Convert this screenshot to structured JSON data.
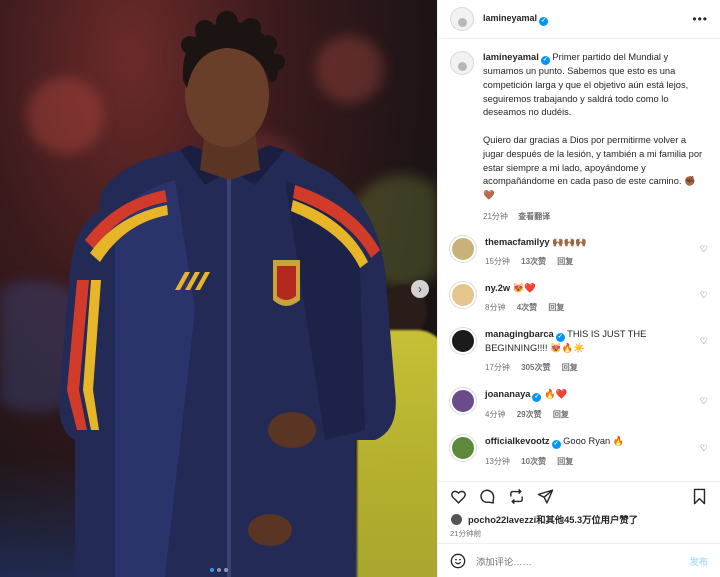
{
  "post": {
    "username": "lamineyamal",
    "more_label": "•••"
  },
  "caption": {
    "username": "lamineyamal",
    "text_1": "Primer partido del Mundial y sumamos un punto. Sabemos que esto es una competición larga y que el objetivo aún está lejos, seguiremos trabajando y saldrá todo como lo deseamos no dudéis.",
    "text_2": "Quiero dar gracias a Dios por permitirme volver a jugar después de la lesión, y también a mi familia por estar siempre a mi lado, apoyándome y acompañándome en cada paso de este camino. ✊🏾",
    "emoji": "🤎",
    "time": "21分钟",
    "translate": "查看翻译"
  },
  "comments": [
    {
      "username": "themacfamilyy",
      "text": "🙌🏾🙌🏾🙌🏾",
      "time": "15分钟",
      "likes": "13次赞",
      "reply": "回复",
      "verified": false,
      "avatar_color": "#c8b27a"
    },
    {
      "username": "ny.2w",
      "text": "😻❤️",
      "time": "8分钟",
      "likes": "4次赞",
      "reply": "回复",
      "verified": false,
      "avatar_color": "#e6c58c"
    },
    {
      "username": "managingbarca",
      "text": "THIS IS JUST THE BEGINNING!!!! 😻🔥☀️",
      "time": "17分钟",
      "likes": "305次赞",
      "reply": "回复",
      "verified": true,
      "avatar_color": "#1b1b1b"
    },
    {
      "username": "joananaya",
      "text": "🔥❤️",
      "time": "4分钟",
      "likes": "29次赞",
      "reply": "回复",
      "verified": true,
      "avatar_color": "#6b4c8a"
    },
    {
      "username": "officialkevootz",
      "text": "Gooo Ryan 🔥",
      "time": "13分钟",
      "likes": "10次赞",
      "reply": "回复",
      "verified": true,
      "avatar_color": "#5d8a3a"
    }
  ],
  "likes": {
    "text_user": "pocho22lavezzi",
    "text_rest": "和其他45.3万位用户赞了"
  },
  "timestamp": "21分钟前",
  "add_comment": {
    "placeholder": "添加评论……",
    "post_label": "发布"
  },
  "colors": {
    "verified": "#0095f6",
    "post_disabled": "#b2dffc",
    "active_dot": "#3897f0"
  },
  "carousel": {
    "total": 3,
    "active": 1
  }
}
